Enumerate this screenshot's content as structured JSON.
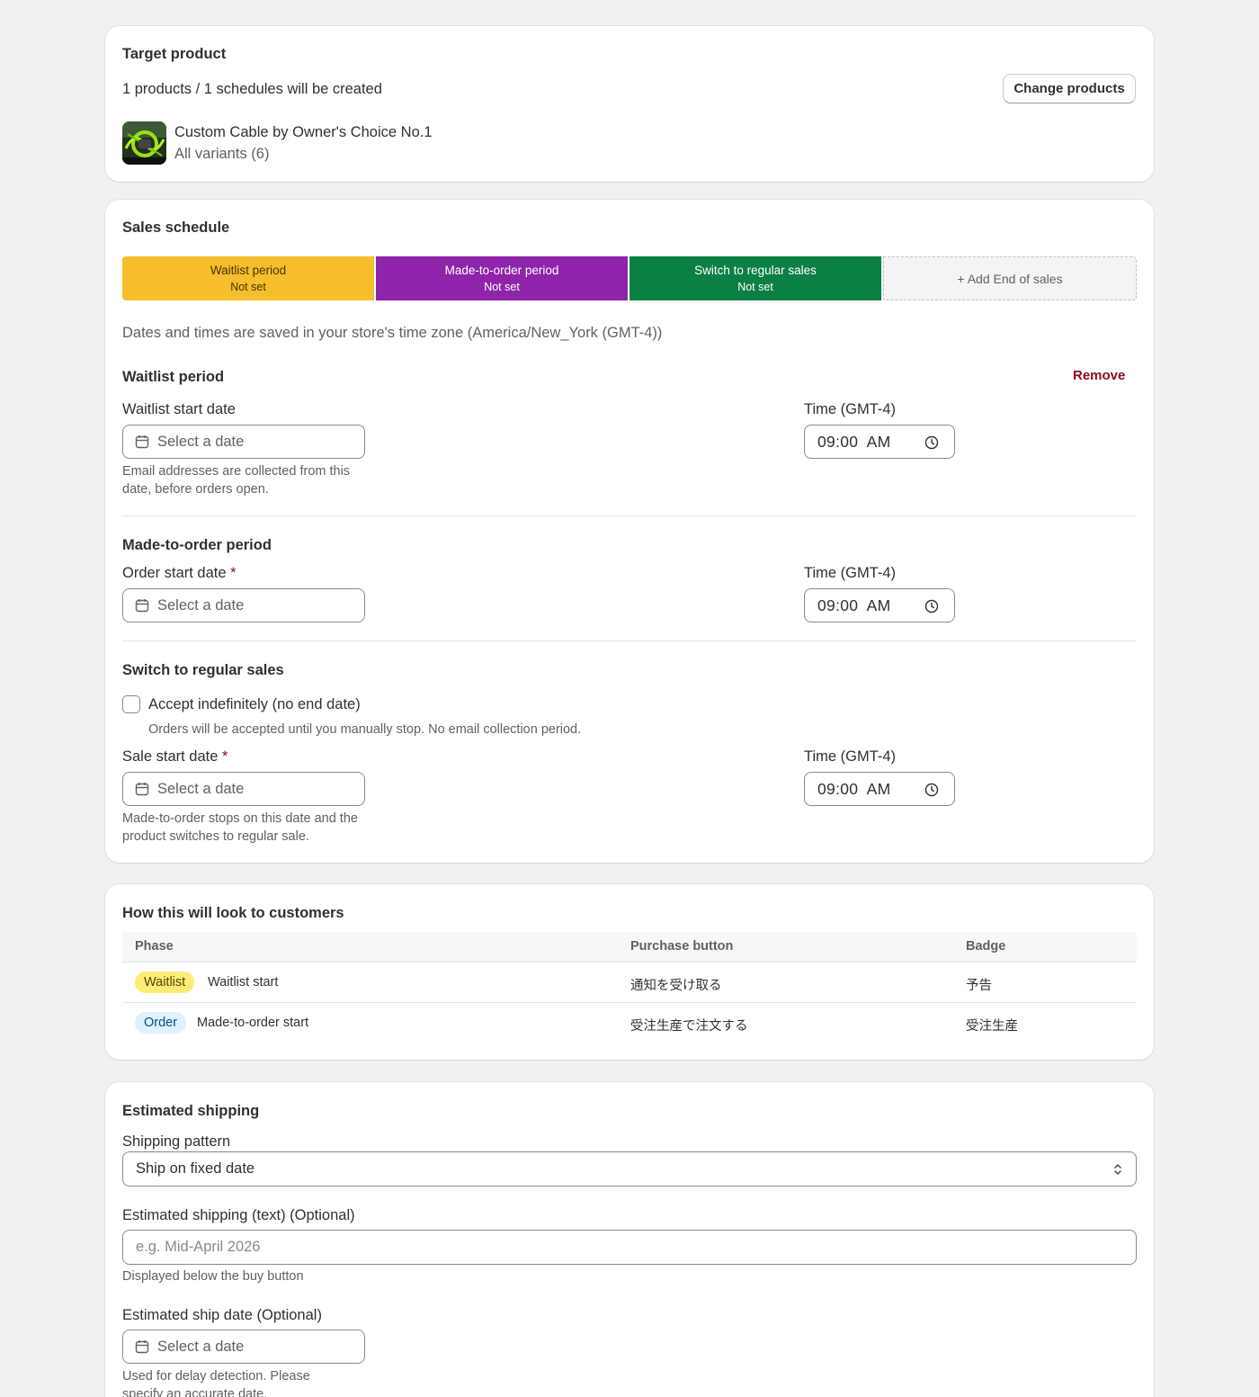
{
  "target_product": {
    "title": "Target product",
    "summary": "1 products / 1 schedules will be created",
    "change_button": "Change products",
    "product_name": "Custom Cable by Owner's Choice No.1",
    "product_variants": "All variants (6)"
  },
  "sales_schedule": {
    "title": "Sales schedule",
    "segments": [
      {
        "label": "Waitlist period",
        "status": "Not set",
        "color": "#f6be2c"
      },
      {
        "label": "Made-to-order period",
        "status": "Not set",
        "color": "#8e24aa"
      },
      {
        "label": "Switch to regular sales",
        "status": "Not set",
        "color": "#0a8043"
      },
      {
        "label": "+ Add End of sales",
        "status": "",
        "color": "#f4f4f4"
      }
    ],
    "timezone_note": "Dates and times are saved in your store's time zone (America/New_York (GMT-4))",
    "waitlist": {
      "title": "Waitlist period",
      "remove": "Remove",
      "date_label": "Waitlist start date",
      "date_placeholder": "Select a date",
      "date_help": "Email addresses are collected from this date, before orders open.",
      "time_label": "Time (GMT-4)",
      "time_value": "09:00  AM"
    },
    "made_to_order": {
      "title": "Made-to-order period",
      "date_label": "Order start date",
      "required": "*",
      "date_placeholder": "Select a date",
      "time_label": "Time (GMT-4)",
      "time_value": "09:00  AM"
    },
    "regular": {
      "title": "Switch to regular sales",
      "checkbox_label": "Accept indefinitely (no end date)",
      "checkbox_help": "Orders will be accepted until you manually stop. No email collection period.",
      "date_label": "Sale start date",
      "required": "*",
      "date_placeholder": "Select a date",
      "date_help": "Made-to-order stops on this date and the product switches to regular sale.",
      "time_label": "Time (GMT-4)",
      "time_value": "09:00  AM"
    }
  },
  "preview": {
    "title": "How this will look to customers",
    "columns": [
      "Phase",
      "Purchase button",
      "Badge"
    ],
    "rows": [
      {
        "pill": "Waitlist",
        "pill_color": "#ffeb78",
        "phase": "Waitlist start",
        "button": "通知を受け取る",
        "badge": "予告"
      },
      {
        "pill": "Order",
        "pill_color": "#e0f0ff",
        "phase": "Made-to-order start",
        "button": "受注生産で注文する",
        "badge": "受注生産"
      }
    ]
  },
  "shipping": {
    "title": "Estimated shipping",
    "pattern_label": "Shipping pattern",
    "pattern_value": "Ship on fixed date",
    "text_label": "Estimated shipping (text) (Optional)",
    "text_placeholder": "e.g. Mid-April 2026",
    "text_help": "Displayed below the buy button",
    "date_label": "Estimated ship date (Optional)",
    "date_placeholder": "Select a date",
    "date_help": "Used for delay detection. Please specify an accurate date."
  }
}
